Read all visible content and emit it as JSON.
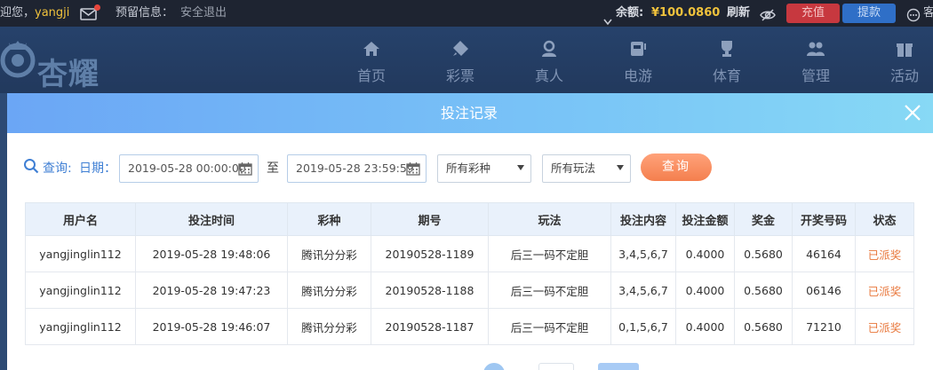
{
  "topbar": {
    "welcome": "迎您，",
    "username": "yangji",
    "reserved_info": "预留信息：",
    "logout": "安全退出",
    "balance_label": "余额:",
    "balance_value": "¥100.0860",
    "refresh": "刷新",
    "recharge": "充值",
    "withdraw": "提款",
    "service": "客"
  },
  "header": {
    "logo_text": "杏耀",
    "nav": [
      {
        "label": "首页",
        "icon": "home-icon"
      },
      {
        "label": "彩票",
        "icon": "lottery-icon"
      },
      {
        "label": "真人",
        "icon": "live-dealer-icon"
      },
      {
        "label": "电游",
        "icon": "slot-machine-icon"
      },
      {
        "label": "体育",
        "icon": "trophy-icon"
      },
      {
        "label": "管理",
        "icon": "users-icon"
      },
      {
        "label": "活动",
        "icon": "gift-icon"
      }
    ]
  },
  "modal": {
    "title": "投注记录",
    "filters": {
      "query_label": "查询:",
      "date_label": "日期：",
      "date_from": "2019-05-28 00:00:00",
      "to_label": "至",
      "date_to": "2019-05-28 23:59:59",
      "lottery_select": "所有彩种",
      "play_select": "所有玩法",
      "query_button": "查询"
    },
    "table": {
      "headers": [
        "用户名",
        "投注时间",
        "彩种",
        "期号",
        "玩法",
        "投注内容",
        "投注金额",
        "奖金",
        "开奖号码",
        "状态"
      ],
      "rows": [
        [
          "yangjinglin112",
          "2019-05-28 19:48:06",
          "腾讯分分彩",
          "20190528-1189",
          "后三一码不定胆",
          "3,4,5,6,7",
          "0.4000",
          "0.5680",
          "46164",
          "已派奖"
        ],
        [
          "yangjinglin112",
          "2019-05-28 19:47:23",
          "腾讯分分彩",
          "20190528-1188",
          "后三一码不定胆",
          "3,4,5,6,7",
          "0.4000",
          "0.5680",
          "06146",
          "已派奖"
        ],
        [
          "yangjinglin112",
          "2019-05-28 19:46:07",
          "腾讯分分彩",
          "20190528-1187",
          "后三一码不定胆",
          "0,1,5,6,7",
          "0.4000",
          "0.5680",
          "71210",
          "已派奖"
        ]
      ]
    }
  },
  "colors": {
    "accent_gold": "#f0c23c",
    "status_orange": "#e8763a",
    "header_blue": "#6ba6f5",
    "query_button": "#f47f4e"
  }
}
